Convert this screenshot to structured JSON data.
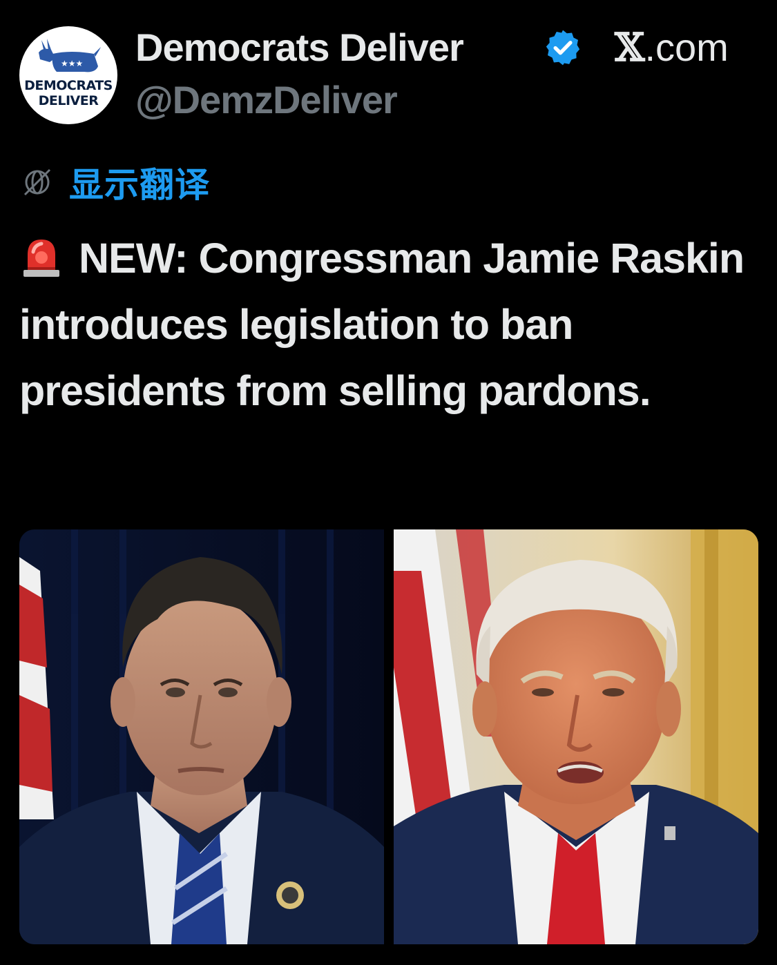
{
  "account": {
    "display_name": "Democrats Deliver",
    "handle": "@DemzDeliver",
    "verified": true,
    "avatar_text_line1": "DEMOCRATS",
    "avatar_text_line2": "DELIVER",
    "avatar_icon": "donkey-logo-icon"
  },
  "site_label_x": "𝕏",
  "site_label_rest": ".com",
  "translate": {
    "label": "显示翻译",
    "icon": "translate-globe-icon"
  },
  "post": {
    "emoji": "siren-icon",
    "text": "NEW: Congressman Jamie Raskin introduces legislation to ban presidents from selling pardons."
  },
  "media": {
    "images": [
      {
        "name": "photo-jamie-raskin"
      },
      {
        "name": "photo-donald-trump"
      }
    ]
  },
  "colors": {
    "background": "#000000",
    "text": "#e7e9ea",
    "handle": "#6e767d",
    "link": "#1d9bf0",
    "verified": "#1d9bf0",
    "avatar_navy": "#0b1f3f",
    "avatar_blue": "#2d5aa8"
  }
}
